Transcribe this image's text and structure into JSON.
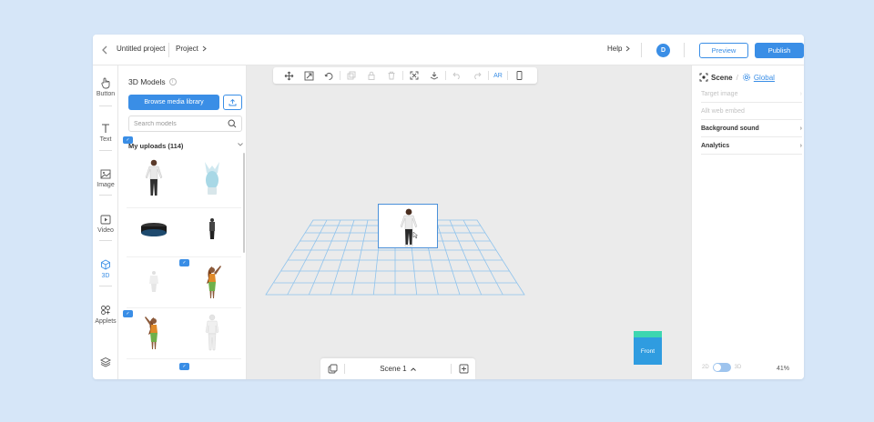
{
  "topbar": {
    "title": "Untitled project",
    "project_label": "Project",
    "help_label": "Help",
    "avatar_initial": "D",
    "preview_label": "Preview",
    "publish_label": "Publish"
  },
  "rail": {
    "items": [
      {
        "label": "Button",
        "icon": "hand-pointer-icon"
      },
      {
        "label": "Text",
        "icon": "text-t-icon"
      },
      {
        "label": "Image",
        "icon": "image-icon"
      },
      {
        "label": "Video",
        "icon": "video-play-icon"
      },
      {
        "label": "3D",
        "icon": "cube-icon",
        "active": true
      },
      {
        "label": "Applets",
        "icon": "applets-grid-icon"
      }
    ],
    "bottom_icon": "layers-icon"
  },
  "left_panel": {
    "title": "3D Models",
    "browse_label": "Browse media library",
    "search_placeholder": "Search models",
    "uploads_label": "My uploads (114)"
  },
  "canvas": {
    "toolbar": {
      "ar_label": "AR"
    },
    "view_cube_label": "Front",
    "scene_label": "Scene 1"
  },
  "right_panel": {
    "tab_scene": "Scene",
    "tab_global": "Global",
    "rows": [
      {
        "label": "Target image",
        "style": "dim"
      },
      {
        "label": "Allt web embed",
        "style": "dim"
      },
      {
        "label": "Background sound",
        "style": "bold"
      },
      {
        "label": "Analytics",
        "style": "bold"
      }
    ],
    "toggle_left": "2D",
    "toggle_right": "3D",
    "zoom": "41%"
  },
  "colors": {
    "accent": "#3a8ee6",
    "background": "#d6e6f8",
    "canvas": "#ebebeb",
    "grid": "#8fc3ec",
    "cube_top": "#3dd6b0"
  }
}
